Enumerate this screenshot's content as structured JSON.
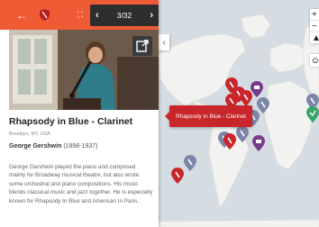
{
  "topbar": {
    "pager_text": "3/32",
    "accent_color": "#ef5b35",
    "icons": [
      "back-arrow-icon",
      "shield-logo-icon",
      "fullscreen-icon",
      "chevron-left-icon",
      "chevron-right-icon"
    ]
  },
  "story": {
    "title": "Rhapsody in Blue - Clarinet",
    "location": "Brooklyn, NY, USA",
    "composer_name": "George Gershwin",
    "composer_years": "(1898-1937)",
    "description": "George Gershwin played the piano and composed mainly for Broadway musical theatre, but also wrote some orchestral and piano compositions. His music blends classical music and jazz together. He is especially known for Rhapsody In Blue and American In Paris."
  },
  "map": {
    "tooltip": "Rhapsody in Blue - Clarinet",
    "zoom_in": "+",
    "zoom_out": "−",
    "pin_colors": {
      "active": "#c8262b",
      "default": "#7b86a8",
      "building": "#7a3a8c",
      "other": "#3aa36a"
    }
  }
}
